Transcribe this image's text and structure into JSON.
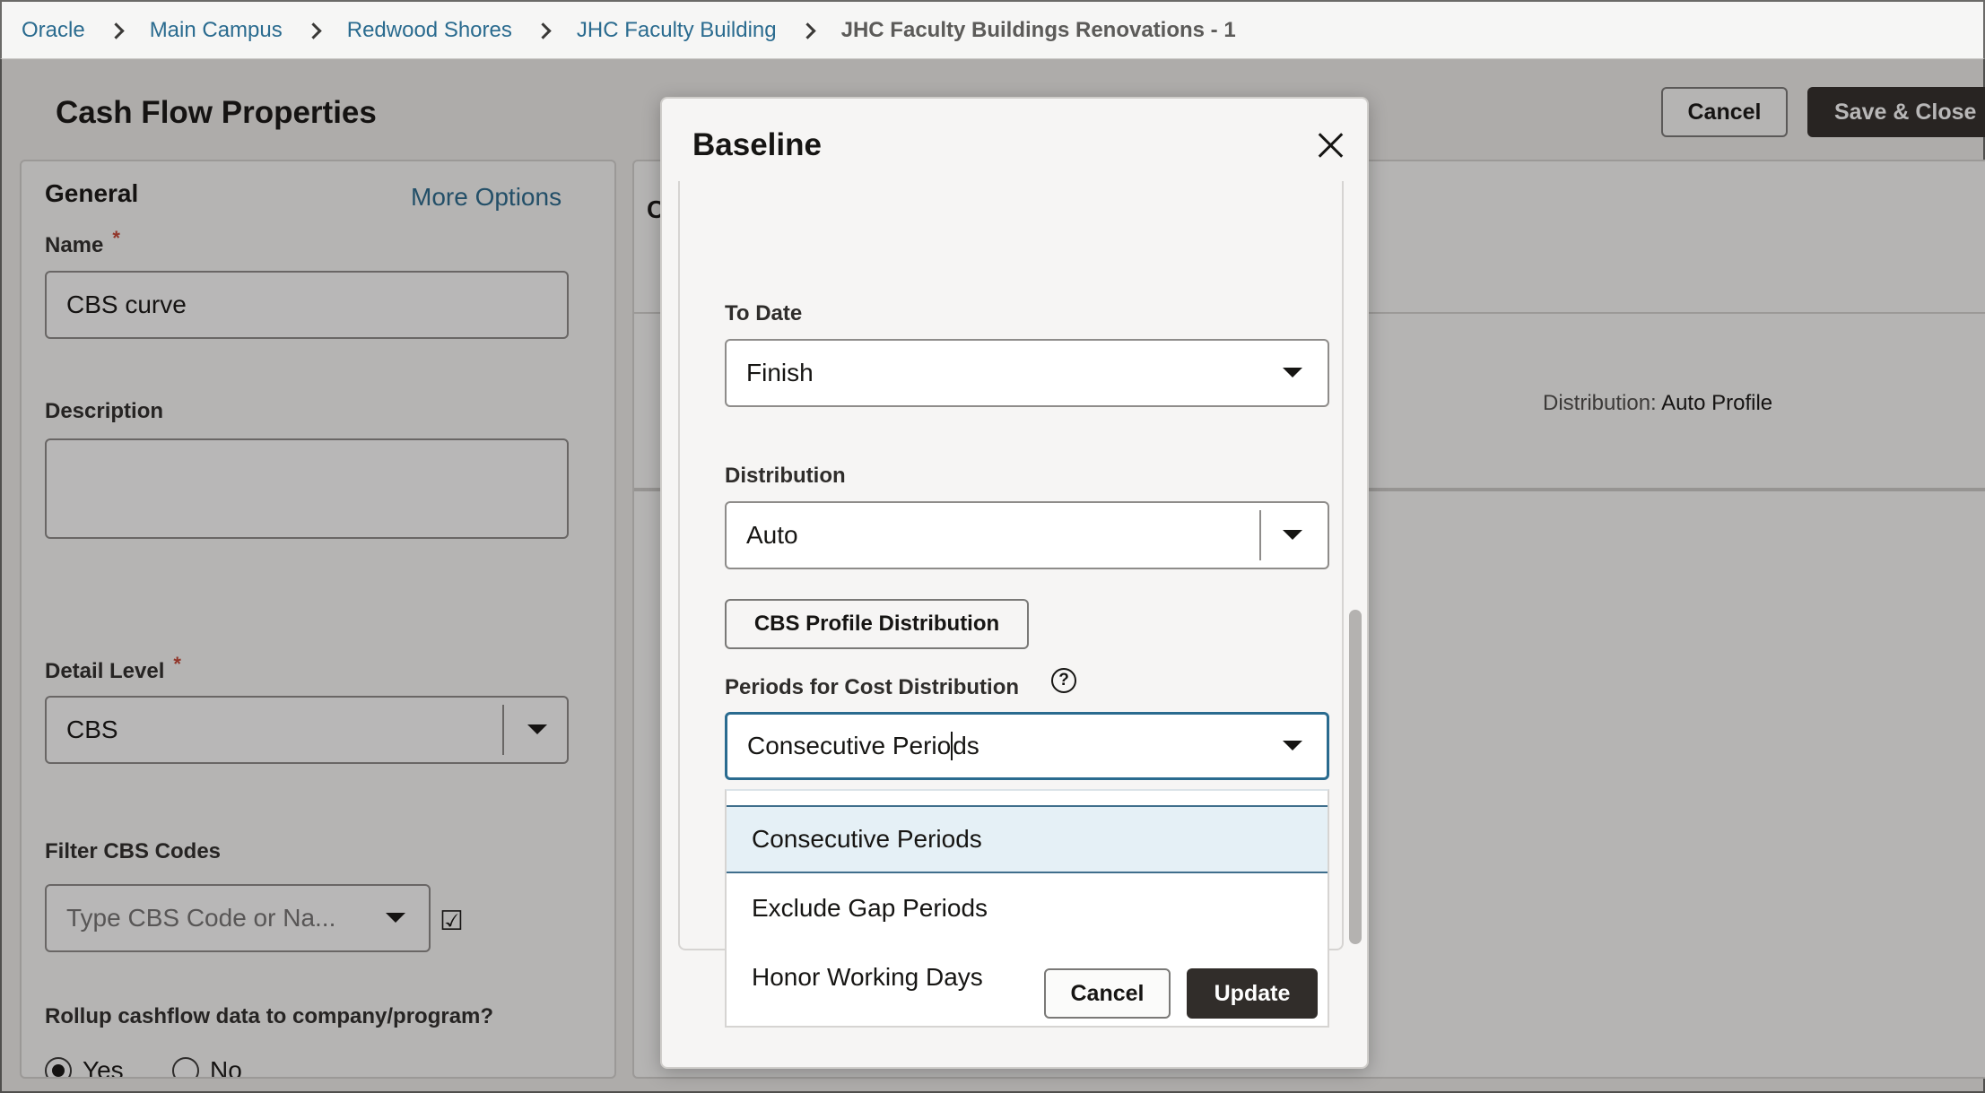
{
  "breadcrumb": {
    "items": [
      "Oracle",
      "Main Campus",
      "Redwood Shores",
      "JHC Faculty Building"
    ],
    "current": "JHC Faculty Buildings Renovations - 1"
  },
  "page": {
    "title": "Cash Flow Properties",
    "cancel_label": "Cancel",
    "save_close_label": "Save & Close"
  },
  "general": {
    "title": "General",
    "more_options": "More Options",
    "name_label": "Name",
    "name_value": "CBS curve",
    "description_label": "Description",
    "description_value": "",
    "detail_level_label": "Detail Level",
    "detail_level_value": "CBS",
    "filter_label": "Filter CBS Codes",
    "filter_placeholder": "Type CBS Code or Na...",
    "rollup_label": "Rollup cashflow data to company/program?",
    "yes_label": "Yes",
    "no_label": "No",
    "required_mark": "*"
  },
  "right_panel": {
    "heading_partial": "C",
    "distribution_label": "Distribution:",
    "distribution_value": "Auto Profile"
  },
  "dialog": {
    "title": "Baseline",
    "to_date_label": "To Date",
    "to_date_value": "Finish",
    "distribution_label": "Distribution",
    "distribution_value": "Auto",
    "cbs_profile_button": "CBS Profile Distribution",
    "periods_label": "Periods for Cost Distribution",
    "periods_value_before_cursor": "Consecutive Perio",
    "periods_value_after_cursor": "ds",
    "help_glyph": "?",
    "options": [
      "Consecutive Periods",
      "Exclude Gap Periods",
      "Honor Working Days"
    ],
    "selected_option": "Consecutive Periods",
    "cancel_label": "Cancel",
    "update_label": "Update"
  }
}
